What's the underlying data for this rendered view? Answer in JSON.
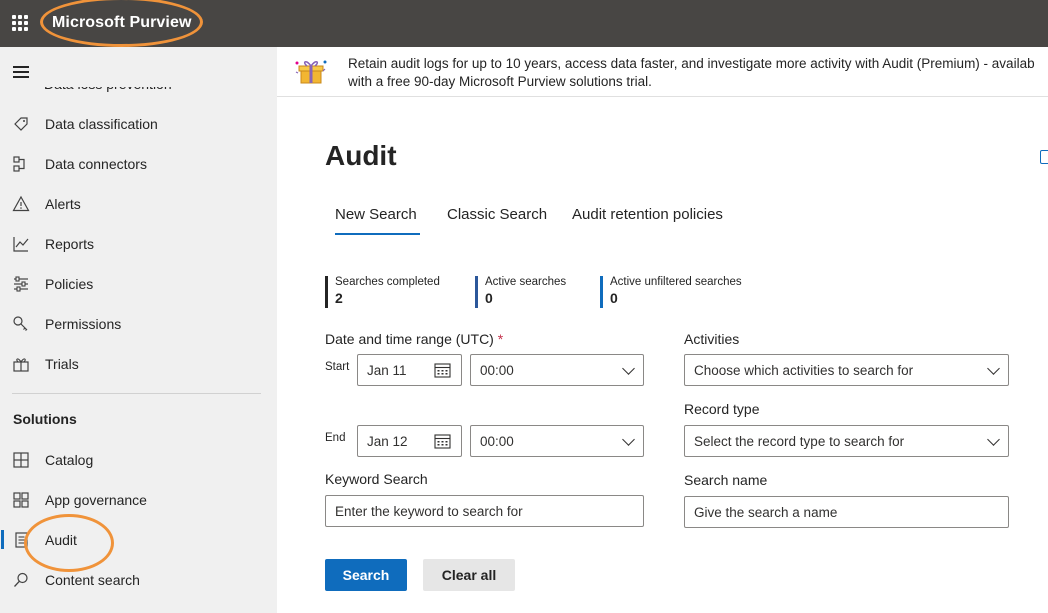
{
  "app": {
    "title": "Microsoft Purview"
  },
  "sidebar": {
    "partial_item": "Data loss prevention",
    "items": [
      {
        "label": "Data classification",
        "icon": "tag-icon"
      },
      {
        "label": "Data connectors",
        "icon": "connector-icon"
      },
      {
        "label": "Alerts",
        "icon": "alert-icon"
      },
      {
        "label": "Reports",
        "icon": "chart-icon"
      },
      {
        "label": "Policies",
        "icon": "sliders-icon"
      },
      {
        "label": "Permissions",
        "icon": "key-icon"
      },
      {
        "label": "Trials",
        "icon": "gift-icon"
      }
    ],
    "solutions_title": "Solutions",
    "solutions": [
      {
        "label": "Catalog",
        "icon": "grid-icon"
      },
      {
        "label": "App governance",
        "icon": "apps-icon"
      },
      {
        "label": "Audit",
        "icon": "document-icon"
      },
      {
        "label": "Content search",
        "icon": "search-icon"
      }
    ]
  },
  "banner": {
    "line1": "Retain audit logs for up to 10 years, access data faster, and investigate more activity with Audit (Premium) - availab",
    "line2": "with a free 90-day Microsoft Purview solutions trial."
  },
  "main": {
    "title": "Audit",
    "tabs": [
      "New Search",
      "Classic Search",
      "Audit retention policies"
    ],
    "stats": [
      {
        "label": "Searches completed",
        "value": "2",
        "color": "#242424"
      },
      {
        "label": "Active searches",
        "value": "0",
        "color": "#2b579a"
      },
      {
        "label": "Active unfiltered searches",
        "value": "0",
        "color": "#0f6cbd"
      }
    ],
    "form": {
      "date_label": "Date and time range (UTC)",
      "required_mark": "*",
      "start_label": "Start",
      "end_label": "End",
      "start_date": "Jan 11",
      "start_time": "00:00",
      "end_date": "Jan 12",
      "end_time": "00:00",
      "activities_label": "Activities",
      "activities_placeholder": "Choose which activities to search for",
      "record_type_label": "Record type",
      "record_type_placeholder": "Select the record type to search for",
      "keyword_label": "Keyword Search",
      "keyword_placeholder": "Enter the keyword to search for",
      "search_name_label": "Search name",
      "search_name_placeholder": "Give the search a name"
    },
    "buttons": {
      "search": "Search",
      "clear": "Clear all"
    }
  },
  "colors": {
    "accent": "#0f6cbd",
    "topbar": "#484644",
    "annotation": "#f0933a"
  }
}
